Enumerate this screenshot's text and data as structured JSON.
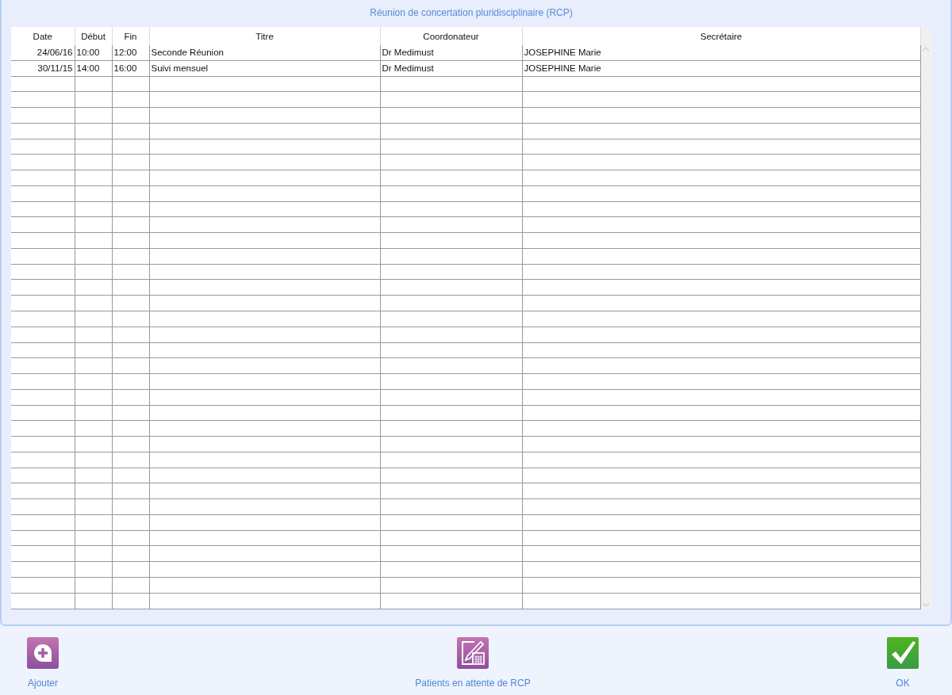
{
  "window": {
    "title": "Réunion de concertation pluridisciplinaire (RCP)"
  },
  "table": {
    "columns": [
      "Date",
      "Début",
      "Fin",
      "Titre",
      "Coordonateur",
      "Secrétaire"
    ],
    "rows": [
      [
        "24/06/16",
        "10:00",
        "12:00",
        "Seconde Réunion",
        "Dr Medimust",
        "JOSEPHINE Marie"
      ],
      [
        "30/11/15",
        "14:00",
        "16:00",
        "Suivi mensuel",
        "Dr Medimust",
        "JOSEPHINE Marie"
      ]
    ]
  },
  "actions": [
    {
      "kind": "add",
      "label": "Ajouter"
    },
    {
      "kind": "waiting",
      "label": "Patients en attente de RCP"
    },
    {
      "kind": "ok",
      "label": "OK"
    }
  ]
}
